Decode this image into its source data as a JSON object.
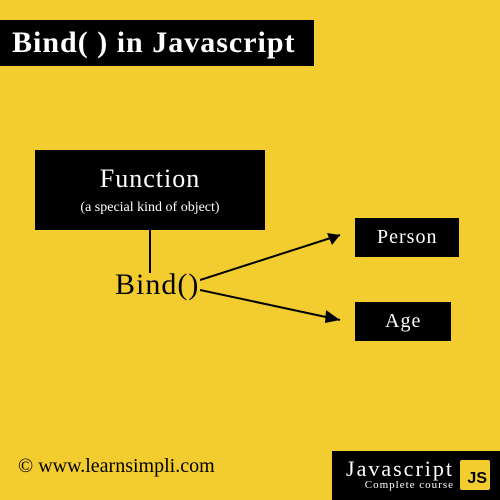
{
  "title": "Bind( ) in Javascript",
  "diagram": {
    "box_title": "Function",
    "box_subtitle": "(a special kind of object)",
    "method_label": "Bind()",
    "targets": [
      "Person",
      "Age"
    ]
  },
  "credit": "© www.learnsimpli.com",
  "footer": {
    "title": "Javascript",
    "subtitle": "Complete course",
    "icon_text": "JS"
  },
  "colors": {
    "bg": "#f3cc30",
    "ink": "#000000",
    "text_light": "#ffffff"
  }
}
